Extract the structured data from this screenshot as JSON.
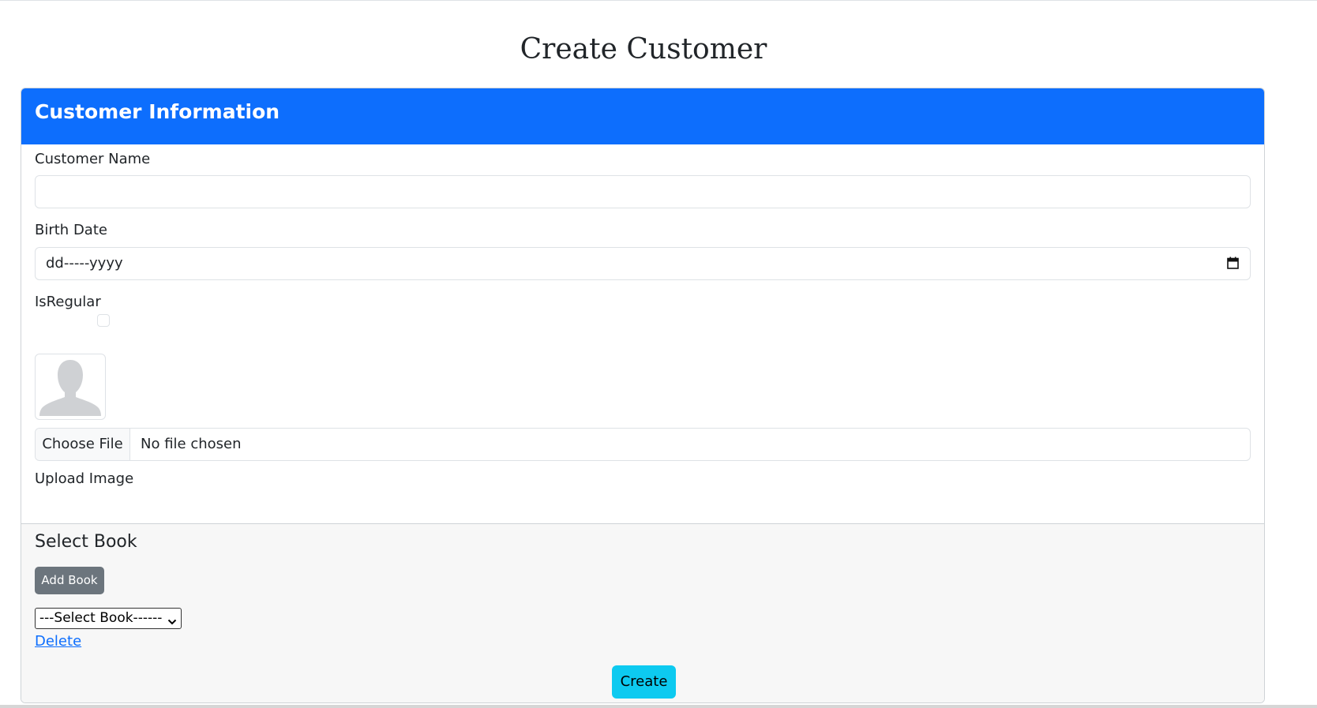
{
  "page": {
    "title": "Create Customer"
  },
  "card": {
    "header_title": "Customer Information",
    "customer_name": {
      "label": "Customer Name",
      "value": ""
    },
    "birth_date": {
      "label": "Birth Date",
      "placeholder": "dd-----yyyy",
      "icon": "calendar-icon"
    },
    "is_regular": {
      "label": "IsRegular",
      "checked": false
    },
    "avatar": {
      "icon": "user-silhouette-icon"
    },
    "file_input": {
      "button_label": "Choose File",
      "status_text": "No file chosen"
    },
    "upload_label": "Upload Image"
  },
  "footer": {
    "title": "Select Book",
    "add_book_label": "Add Book",
    "select": {
      "selected": "---Select Book------",
      "icon": "chevron-down-icon"
    },
    "delete_label": "Delete",
    "create_label": "Create"
  },
  "colors": {
    "primary": "#0d6efd",
    "secondary": "#6c757d",
    "info": "#0dcaf0",
    "footer_bg": "#f7f7f7"
  }
}
